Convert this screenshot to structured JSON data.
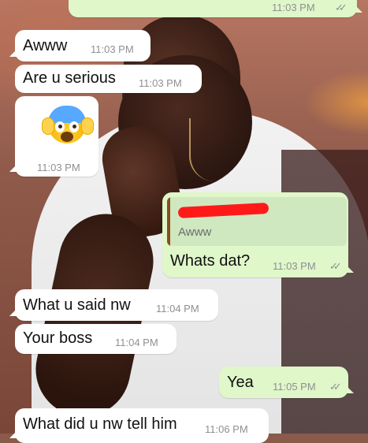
{
  "chat": {
    "messages": [
      {
        "direction": "outgoing",
        "time": "11:03 PM",
        "ticks": "✓✓"
      },
      {
        "direction": "incoming",
        "text": "Awww",
        "time": "11:03 PM"
      },
      {
        "direction": "incoming",
        "text": "Are u serious",
        "time": "11:03 PM"
      },
      {
        "direction": "incoming",
        "type": "emoji",
        "emoji_name": "face-screaming-in-fear",
        "time": "11:03 PM"
      },
      {
        "direction": "outgoing",
        "quote": {
          "text": "Awww"
        },
        "text": "Whats dat?",
        "time": "11:03 PM",
        "ticks": "✓✓"
      },
      {
        "direction": "incoming",
        "text": "What u said nw",
        "time": "11:04 PM"
      },
      {
        "direction": "incoming",
        "text": "Your boss",
        "time": "11:04 PM"
      },
      {
        "direction": "outgoing",
        "text": "Yea",
        "time": "11:05 PM",
        "ticks": "✓✓"
      },
      {
        "direction": "incoming",
        "text": "What did u nw tell him",
        "time": "11:06 PM"
      }
    ]
  },
  "colors": {
    "incoming_bubble": "#ffffff",
    "outgoing_bubble": "#dff7c9",
    "timestamp": "#8e9092",
    "quote_bar": "#8a4c1f",
    "redaction": "#ff1a1a"
  }
}
